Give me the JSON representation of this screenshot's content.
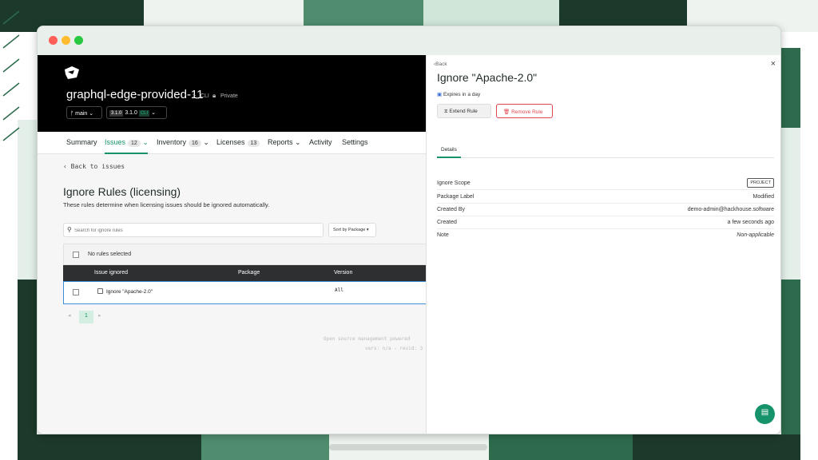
{
  "repo": {
    "name": "graphql-edge-provided-11",
    "cli_tag": ">_ CLI",
    "visibility": "Private",
    "branch": "main",
    "version_badge": "3.1.0",
    "version": "3.1.0",
    "version_tag": "CLI"
  },
  "nav": {
    "summary": "Summary",
    "issues": "Issues",
    "issues_count": "12",
    "inventory": "Inventory",
    "inventory_count": "16",
    "licenses": "Licenses",
    "licenses_count": "13",
    "reports": "Reports",
    "activity": "Activity",
    "settings": "Settings"
  },
  "main": {
    "back": "Back to issues",
    "title": "Ignore Rules (licensing)",
    "subtitle": "These rules determine when licensing issues should be ignored automatically.",
    "search_placeholder": "Search for ignore rules",
    "sort": "Sort by Package",
    "selection": "No rules selected",
    "columns": [
      "Issue ignored",
      "Package",
      "Version"
    ],
    "rows": [
      {
        "issue": "Ignore \"Apache-2.0\"",
        "package": "",
        "version": "All"
      }
    ],
    "page": "1",
    "footer_line1": "Open source management powered",
    "footer_line2": "vers: n/a - revid: 3"
  },
  "panel": {
    "back": "Back",
    "title": "Ignore \"Apache-2.0\"",
    "expires": "Expires in a day",
    "extend": "Extend Rule",
    "remove": "Remove Rule",
    "tab": "Details",
    "details": [
      {
        "label": "Ignore Scope",
        "value": "PROJECT"
      },
      {
        "label": "Package Label",
        "value": "Modified"
      },
      {
        "label": "Created By",
        "value": "demo-admin@hackhouse.software"
      },
      {
        "label": "Created",
        "value": "a few seconds ago"
      },
      {
        "label": "Note",
        "value": "Non-applicable"
      }
    ]
  },
  "colors": {
    "accent": "#16936a",
    "danger": "#e0464e",
    "header": "#000000",
    "table_header": "#2d2f31",
    "bg_green": "#2d6b4c",
    "bg_dark": "#1c3a2b",
    "bg_light": "#e8f1ec"
  }
}
